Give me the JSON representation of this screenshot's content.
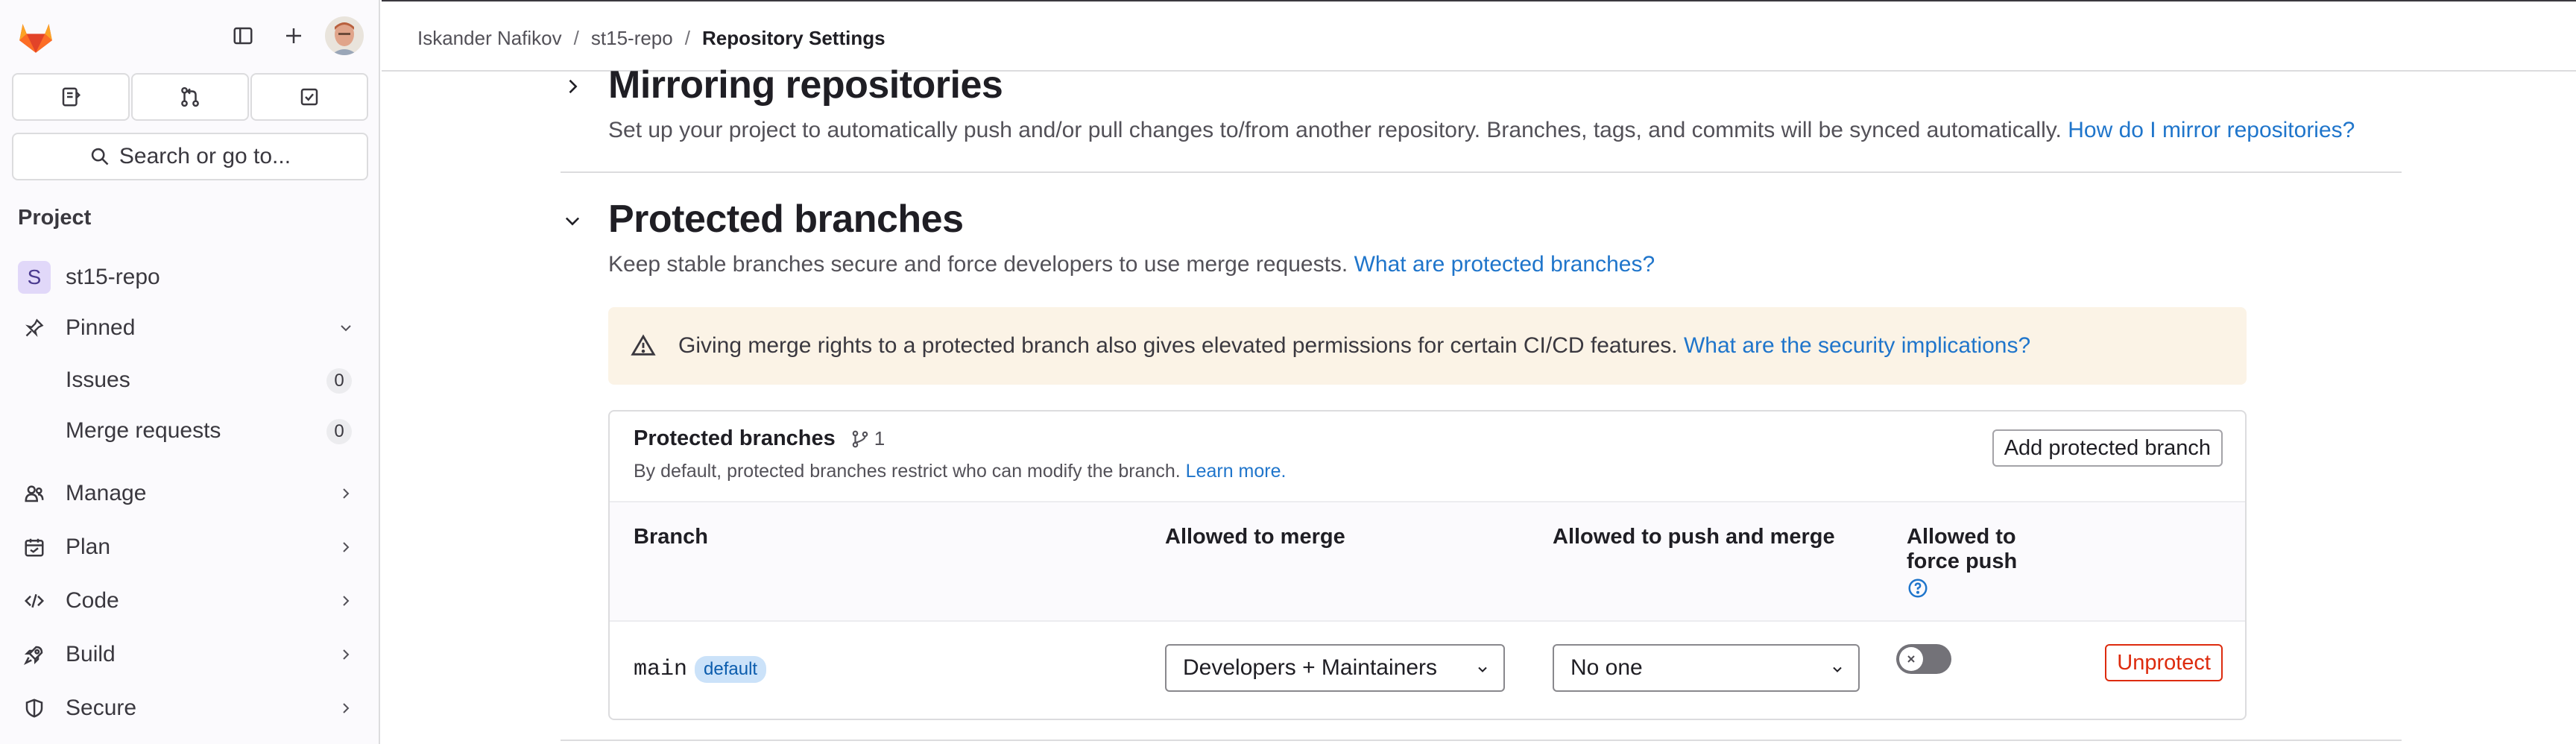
{
  "sidebar": {
    "search_label": "Search or go to...",
    "section_title": "Project",
    "project": {
      "initial": "S",
      "name": "st15-repo"
    },
    "pinned": {
      "label": "Pinned",
      "items": [
        {
          "label": "Issues",
          "count": "0"
        },
        {
          "label": "Merge requests",
          "count": "0"
        }
      ]
    },
    "nav": [
      {
        "label": "Manage",
        "icon": "users-icon"
      },
      {
        "label": "Plan",
        "icon": "calendar-icon"
      },
      {
        "label": "Code",
        "icon": "code-icon"
      },
      {
        "label": "Build",
        "icon": "rocket-icon"
      },
      {
        "label": "Secure",
        "icon": "shield-icon"
      }
    ]
  },
  "header": {
    "breadcrumb": [
      "Iskander Nafikov",
      "st15-repo",
      "Repository Settings"
    ]
  },
  "mirroring": {
    "title": "Mirroring repositories",
    "description": "Set up your project to automatically push and/or pull changes to/from another repository. Branches, tags, and commits will be synced automatically.",
    "link": "How do I mirror repositories?"
  },
  "protected": {
    "title": "Protected branches",
    "description": "Keep stable branches secure and force developers to use merge requests.",
    "link": "What are protected branches?",
    "alert": {
      "text": "Giving merge rights to a protected branch also gives elevated permissions for certain CI/CD features.",
      "link": "What are the security implications?"
    },
    "card": {
      "title": "Protected branches",
      "count": "1",
      "subtitle": "By default, protected branches restrict who can modify the branch.",
      "learn_more": "Learn more.",
      "add_button": "Add protected branch",
      "columns": {
        "branch": "Branch",
        "merge": "Allowed to merge",
        "push": "Allowed to push and merge",
        "force_line1": "Allowed to",
        "force_line2": "force push"
      },
      "rows": [
        {
          "branch": "main",
          "badge": "default",
          "merge": "Developers + Maintainers",
          "push": "No one",
          "force_push": false,
          "action": "Unprotect"
        }
      ]
    }
  },
  "colors": {
    "link": "#1f75cb",
    "danger": "#dd2b0e",
    "alert_bg": "#fbf3e6"
  }
}
